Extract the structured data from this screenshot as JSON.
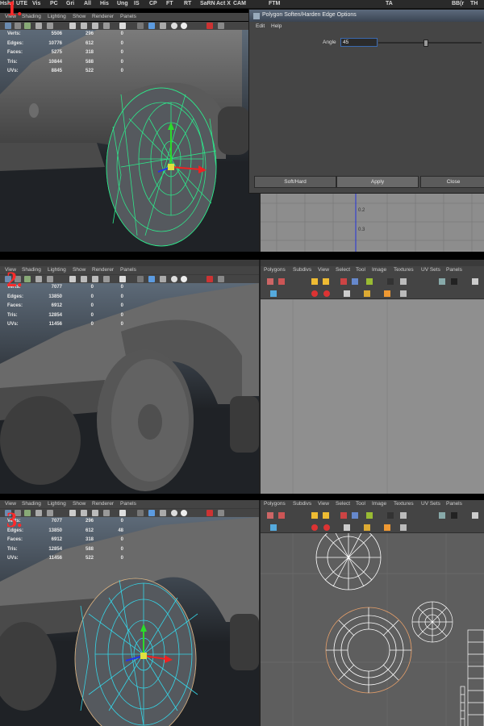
{
  "shelf": {
    "tabs": [
      "Hshd",
      "UTE",
      "Vis",
      "PC",
      "Gri",
      "All",
      "His",
      "Ung",
      "IS",
      "CP",
      "FT",
      "RT",
      "SaRN",
      "Act X",
      "CAM",
      "FTM",
      "TA",
      "BB(r",
      "TH"
    ]
  },
  "viewport_menu": [
    "View",
    "Shading",
    "Lighting",
    "Show",
    "Renderer",
    "Panels"
  ],
  "uv_menu": [
    "Polygons",
    "Subdivs",
    "View",
    "Select",
    "Tool",
    "Image",
    "Textures",
    "UV Sets",
    "Panels"
  ],
  "stats_labels": [
    "Verts:",
    "Edges:",
    "Faces:",
    "Tris:",
    "UVs:"
  ],
  "panels": [
    {
      "step": "1.",
      "stats": [
        [
          "5506",
          "296",
          "0"
        ],
        [
          "10776",
          "612",
          "0"
        ],
        [
          "5275",
          "318",
          "0"
        ],
        [
          "10844",
          "588",
          "0"
        ],
        [
          "8845",
          "522",
          "0"
        ]
      ]
    },
    {
      "step": "2.",
      "stats": [
        [
          "7077",
          "0",
          "0"
        ],
        [
          "13850",
          "0",
          "0"
        ],
        [
          "6912",
          "0",
          "0"
        ],
        [
          "12854",
          "0",
          "0"
        ],
        [
          "11456",
          "0",
          "0"
        ]
      ]
    },
    {
      "step": "3.",
      "stats": [
        [
          "7077",
          "296",
          "0"
        ],
        [
          "13850",
          "612",
          "48"
        ],
        [
          "6912",
          "318",
          "0"
        ],
        [
          "12854",
          "588",
          "0"
        ],
        [
          "11456",
          "522",
          "0"
        ]
      ]
    }
  ],
  "dialog": {
    "title": "Polygon Soften/Harden Edge Options",
    "menu": [
      "Edit",
      "Help"
    ],
    "angle_label": "Angle",
    "angle_value": "45",
    "buttons": [
      "Soft/Hard",
      "Apply",
      "Close"
    ]
  },
  "uv_ticks": [
    "0.2",
    "0.3"
  ],
  "colors": {
    "step_number": "#ff2a2a",
    "wireframe_selected": "#2ee58a",
    "wireframe_cyan": "#35d6e8",
    "uv_selected": "#e8a06a"
  }
}
